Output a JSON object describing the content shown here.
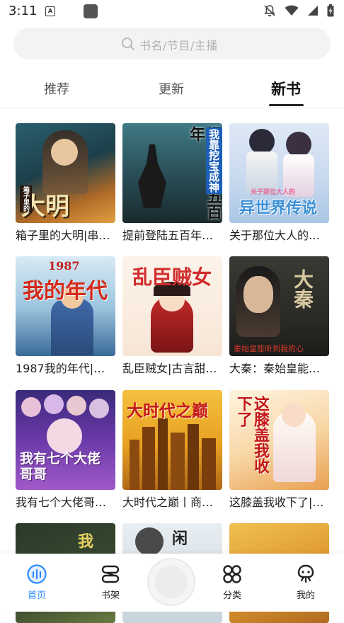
{
  "status": {
    "time": "3:11"
  },
  "search": {
    "placeholder": "书名/节目/主播"
  },
  "tabs": [
    {
      "label": "推荐"
    },
    {
      "label": "更新"
    },
    {
      "label": "新书"
    }
  ],
  "books": [
    {
      "title": "箱子里的大明|串…",
      "cover_text": "大明",
      "cover_sub": "箱子里的"
    },
    {
      "title": "提前登陆五百年…",
      "cover_text": "提前登陆五百年",
      "cover_sub": "我靠挖宝成神"
    },
    {
      "title": "关于那位大人的…",
      "cover_text": "异世界传说",
      "cover_sub": "关于那位大人的"
    },
    {
      "title": "1987我的年代|…",
      "cover_text": "我的年代",
      "cover_sub": "1987"
    },
    {
      "title": "乱臣贼女|古言甜…",
      "cover_text": "乱臣贼女",
      "cover_sub": ""
    },
    {
      "title": "大秦：秦始皇能…",
      "cover_text": "大秦",
      "cover_sub": "秦始皇能听到我的心"
    },
    {
      "title": "我有七个大佬哥…",
      "cover_text": "我有七个大佬哥哥",
      "cover_sub": ""
    },
    {
      "title": "大时代之巅丨商…",
      "cover_text": "大时代之巅",
      "cover_sub": ""
    },
    {
      "title": "这膝盖我收下了|…",
      "cover_text": "这膝盖我收下了",
      "cover_sub": ""
    },
    {
      "title": "",
      "cover_text": "我",
      "cover_sub": ""
    },
    {
      "title": "",
      "cover_text": "闲",
      "cover_sub": ""
    },
    {
      "title": "",
      "cover_text": "",
      "cover_sub": ""
    }
  ],
  "nav": {
    "home": "首页",
    "bookshelf": "书架",
    "category": "分类",
    "mine": "我的"
  },
  "colors": {
    "accent": "#2d8cff"
  }
}
